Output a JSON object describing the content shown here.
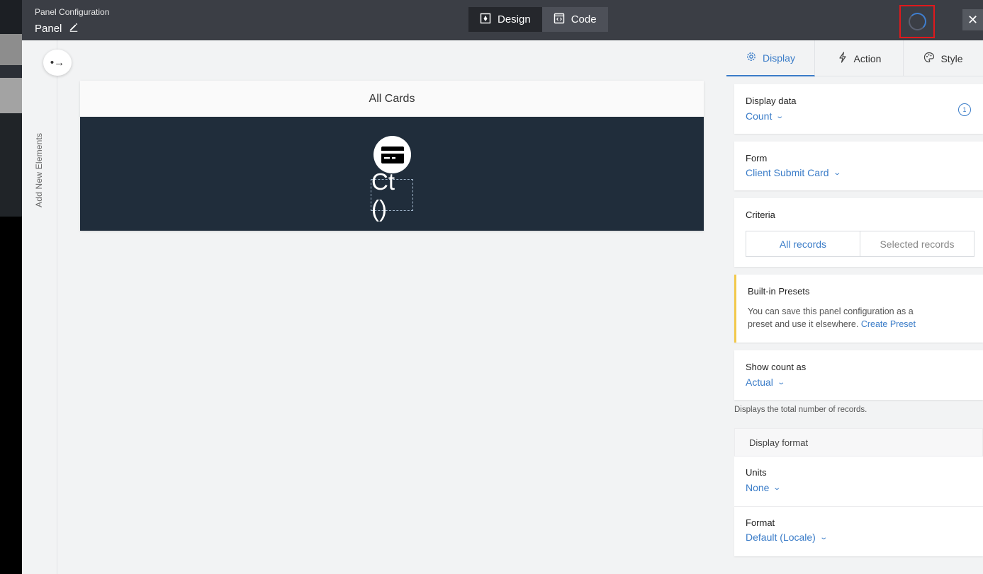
{
  "header": {
    "subtitle": "Panel Configuration",
    "title": "Panel",
    "modes": {
      "design": "Design",
      "code": "Code"
    },
    "close_glyph": "✕"
  },
  "rail": {
    "label": "Add New Elements",
    "toggle_glyph": "•→"
  },
  "canvas": {
    "card_title": "All Cards",
    "card_value": "Ct ()"
  },
  "side": {
    "tabs": {
      "display": "Display",
      "action": "Action",
      "style": "Style"
    },
    "display_data": {
      "label": "Display data",
      "value": "Count",
      "info_badge": "1"
    },
    "form": {
      "label": "Form",
      "value": "Client Submit Card"
    },
    "criteria": {
      "label": "Criteria",
      "all": "All records",
      "selected": "Selected records"
    },
    "presets": {
      "title": "Built-in Presets",
      "text": "You can save this panel configuration as a preset and use it elsewhere.",
      "link": "Create Preset"
    },
    "show_count": {
      "label": "Show count as",
      "value": "Actual"
    },
    "helper": "Displays the total number of records.",
    "display_format": "Display format",
    "units": {
      "label": "Units",
      "value": "None"
    },
    "format": {
      "label": "Format",
      "value": "Default (Locale)"
    },
    "chevron": "⌄"
  },
  "colors": {
    "accent": "#3a7cc8",
    "card_bg": "#202d3b",
    "header_bg": "#3b3e45",
    "highlight": "#e0191c",
    "preset_bar": "#f2c94c"
  }
}
